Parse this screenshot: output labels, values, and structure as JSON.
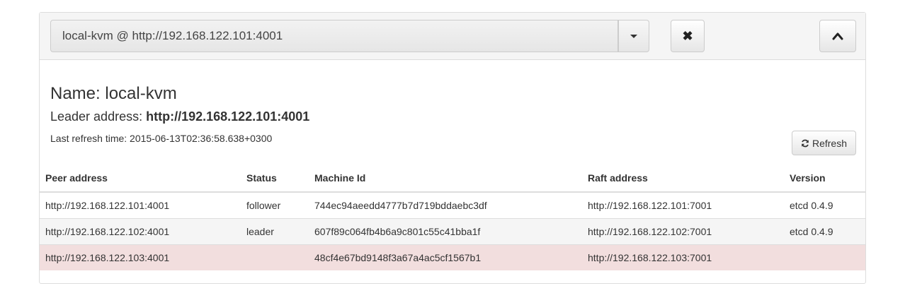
{
  "cluster_select": {
    "value": "local-kvm @ http://192.168.122.101:4001"
  },
  "info": {
    "name_label": "Name: local-kvm",
    "leader_label": "Leader address:",
    "leader_value": "http://192.168.122.101:4001",
    "refresh_time": "Last refresh time: 2015-06-13T02:36:58.638+0300"
  },
  "refresh_button": {
    "label": "Refresh"
  },
  "table": {
    "headers": [
      "Peer address",
      "Status",
      "Machine Id",
      "Raft address",
      "Version"
    ],
    "rows": [
      [
        "http://192.168.122.101:4001",
        "follower",
        "744ec94aeedd4777b7d719bddaebc3df",
        "http://192.168.122.101:7001",
        "etcd 0.4.9"
      ],
      [
        "http://192.168.122.102:4001",
        "leader",
        "607f89c064fb4b6a9c801c55c41bba1f",
        "http://192.168.122.102:7001",
        "etcd 0.4.9"
      ],
      [
        "http://192.168.122.103:4001",
        "",
        "48cf4e67bd9148f3a67a4ac5cf1567b1",
        "http://192.168.122.103:7001",
        ""
      ]
    ]
  },
  "icons": {
    "dropdown": "caret-down-icon",
    "close": "close-icon",
    "collapse": "chevron-up-icon",
    "refresh": "refresh-icon"
  },
  "colors": {
    "heading_bg": "#f5f5f5",
    "striped_row": "#f5f5f5",
    "danger_row": "#f2dede"
  }
}
